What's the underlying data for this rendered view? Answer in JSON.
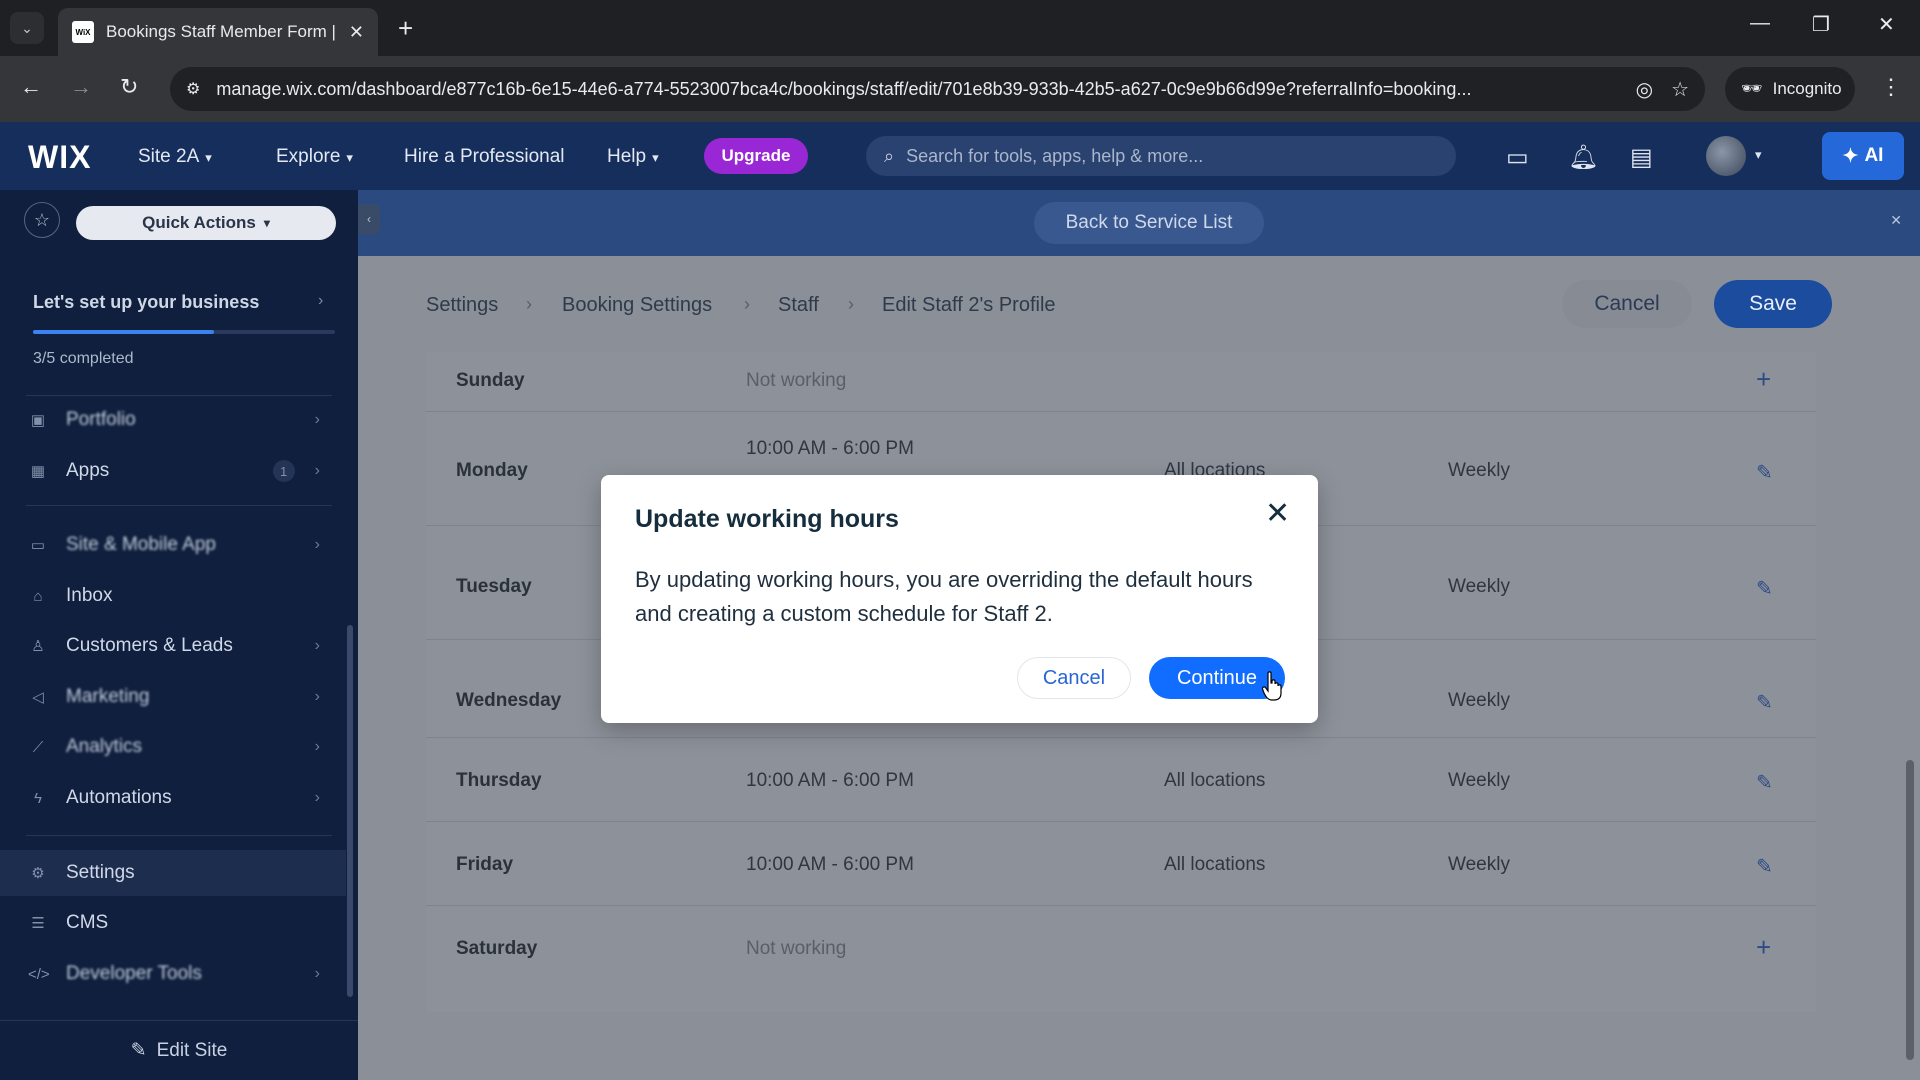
{
  "browser": {
    "tab_title": "Bookings Staff Member Form |",
    "favicon_text": "WiX",
    "url": "manage.wix.com/dashboard/e877c16b-6e15-44e6-a774-5523007bca4c/bookings/staff/edit/701e8b39-933b-42b5-a627-0c9e9b66d99e?referralInfo=booking...",
    "incognito_label": "Incognito"
  },
  "wix_header": {
    "logo": "WIX",
    "site_name": "Site 2A",
    "explore": "Explore",
    "hire": "Hire a Professional",
    "help": "Help",
    "upgrade": "Upgrade",
    "search_placeholder": "Search for tools, apps, help & more...",
    "ai_label": "AI"
  },
  "sidebar": {
    "quick_actions": "Quick Actions",
    "setup_title": "Let's set up your business",
    "setup_status": "3/5 completed",
    "setup_progress": 0.6,
    "items": [
      {
        "label": "Portfolio",
        "icon": "portfolio-icon"
      },
      {
        "label": "Apps",
        "badge": "1",
        "icon": "apps-icon"
      },
      {
        "label": "Site & Mobile App",
        "icon": "site-icon"
      },
      {
        "label": "Inbox",
        "icon": "inbox-icon"
      },
      {
        "label": "Customers & Leads",
        "icon": "customers-icon"
      },
      {
        "label": "Marketing",
        "icon": "marketing-icon"
      },
      {
        "label": "Analytics",
        "icon": "analytics-icon"
      },
      {
        "label": "Automations",
        "icon": "automations-icon"
      },
      {
        "label": "Settings",
        "icon": "settings-icon"
      },
      {
        "label": "CMS",
        "icon": "cms-icon"
      },
      {
        "label": "Developer Tools",
        "icon": "developer-icon"
      }
    ],
    "edit_site": "Edit Site"
  },
  "banner": {
    "back_label": "Back to Service List"
  },
  "breadcrumb": [
    "Settings",
    "Booking Settings",
    "Staff",
    "Edit Staff 2's Profile"
  ],
  "actions": {
    "cancel": "Cancel",
    "save": "Save"
  },
  "schedule": [
    {
      "day": "Sunday",
      "hours": "Not working",
      "location": "",
      "frequency": ""
    },
    {
      "day": "Monday",
      "hours": "10:00 AM - 6:00 PM",
      "location": "All locations",
      "frequency": "Weekly"
    },
    {
      "day": "Tuesday",
      "hours": "",
      "location": "",
      "frequency": "Weekly"
    },
    {
      "day": "Wednesday",
      "hours": "",
      "location": "",
      "frequency": "Weekly"
    },
    {
      "day": "Thursday",
      "hours": "10:00 AM - 6:00 PM",
      "location": "All locations",
      "frequency": "Weekly"
    },
    {
      "day": "Friday",
      "hours": "10:00 AM - 6:00 PM",
      "location": "All locations",
      "frequency": "Weekly"
    },
    {
      "day": "Saturday",
      "hours": "Not working",
      "location": "",
      "frequency": ""
    }
  ],
  "modal": {
    "title": "Update working hours",
    "body": "By updating working hours, you are overriding the default hours and creating a custom schedule for Staff 2.",
    "cancel": "Cancel",
    "continue": "Continue"
  }
}
